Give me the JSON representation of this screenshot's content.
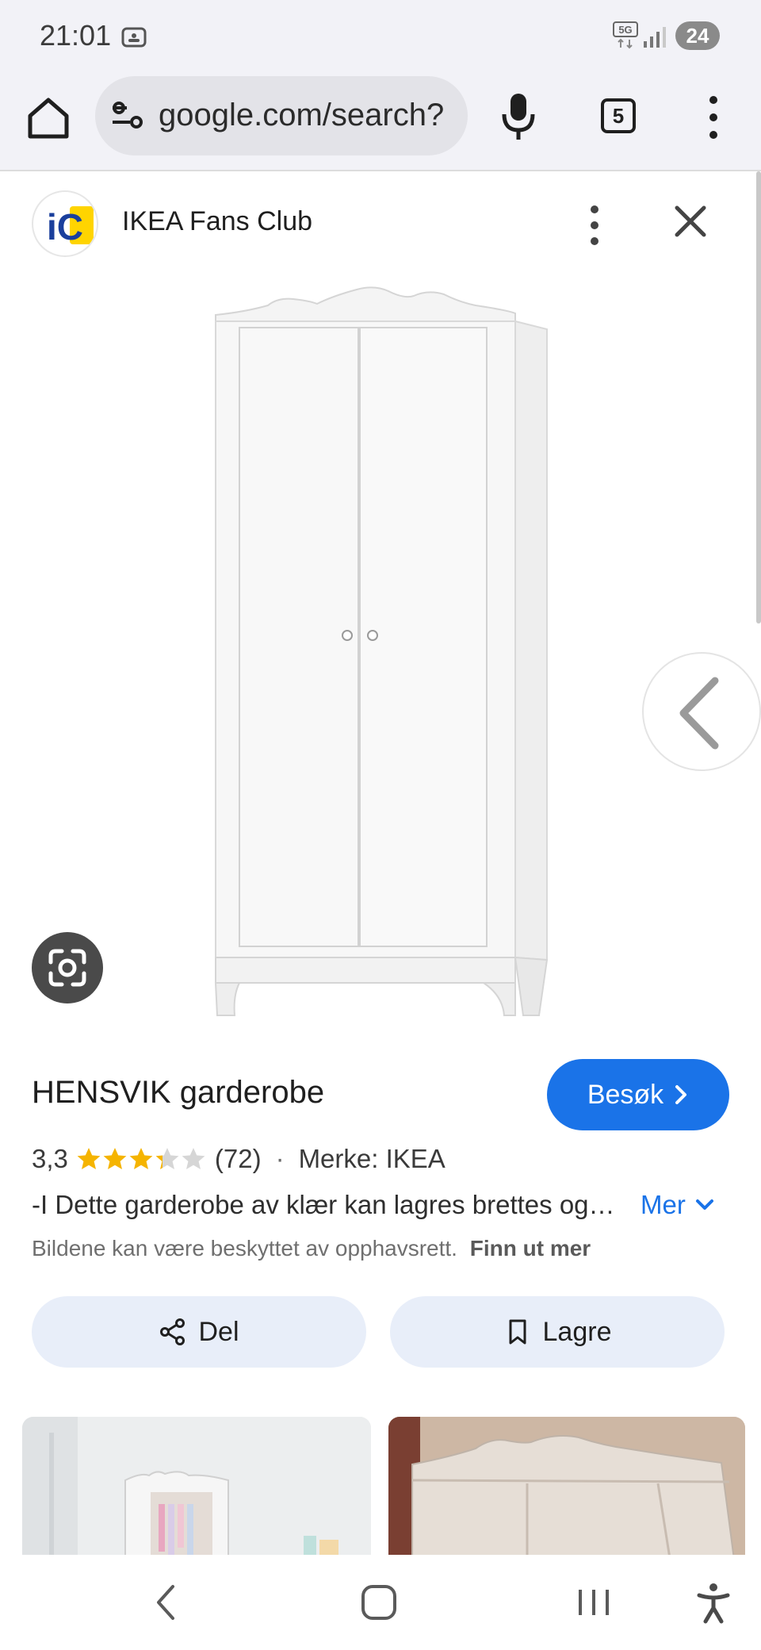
{
  "status": {
    "time": "21:01",
    "network": "5G",
    "battery": "24"
  },
  "toolbar": {
    "url": "google.com/search?",
    "tab_count": "5"
  },
  "source": {
    "logo_text": "iC",
    "name": "IKEA Fans Club"
  },
  "product": {
    "title": "HENSVIK garderobe",
    "visit_label": "Besøk",
    "rating": "3,3",
    "rating_value": 3.3,
    "rating_max": 5,
    "review_count": "(72)",
    "separator": "·",
    "brand": "Merke: IKEA",
    "description": "-I Dette garderobe av klær kan lagres brettes og…",
    "more_label": "Mer",
    "copyright_notice": "Bildene kan være beskyttet av opphavsrett.",
    "learn_more_label": "Finn ut mer"
  },
  "actions": {
    "share_label": "Del",
    "save_label": "Lagre"
  },
  "colors": {
    "accent": "#1a73e8",
    "star": "#f5b400",
    "star_empty": "#d6d6d6",
    "chip_bg": "#e8eef9"
  }
}
